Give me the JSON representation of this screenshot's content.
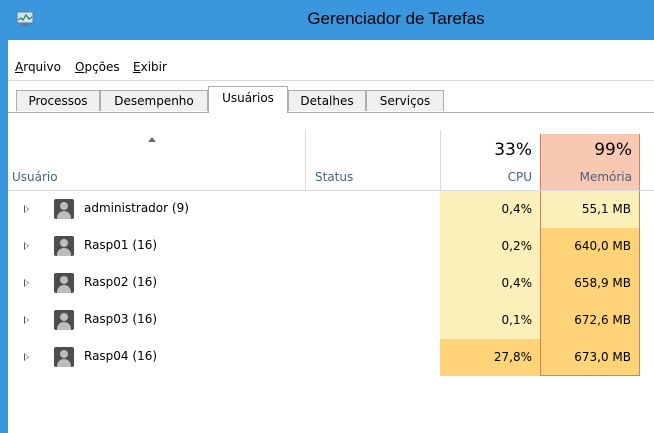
{
  "window": {
    "title": "Gerenciador de Tarefas"
  },
  "menu": [
    {
      "label": "Arquivo",
      "accel": "A",
      "rest": "rquivo"
    },
    {
      "label": "Opções",
      "accel": "O",
      "rest": "pções"
    },
    {
      "label": "Exibir",
      "accel": "E",
      "rest": "xibir"
    }
  ],
  "tabs": [
    "Processos",
    "Desempenho",
    "Usuários",
    "Detalhes",
    "Serviços"
  ],
  "active_tab": "Usuários",
  "columns": {
    "user": "Usuário",
    "status": "Status",
    "cpu": {
      "label": "CPU",
      "pct": "33%"
    },
    "memory": {
      "label": "Memória",
      "pct": "99%"
    }
  },
  "rows": [
    {
      "name": "administrador (9)",
      "status": "",
      "cpu": "0,4%",
      "memory": "55,1 MB"
    },
    {
      "name": "Rasp01 (16)",
      "status": "",
      "cpu": "0,2%",
      "memory": "640,0 MB"
    },
    {
      "name": "Rasp02 (16)",
      "status": "",
      "cpu": "0,4%",
      "memory": "658,9 MB"
    },
    {
      "name": "Rasp03 (16)",
      "status": "",
      "cpu": "0,1%",
      "memory": "672,6 MB"
    },
    {
      "name": "Rasp04 (16)",
      "status": "",
      "cpu": "27,8%",
      "memory": "673,0 MB"
    }
  ],
  "colors": {
    "titlebar": "#3a96dd",
    "cpu_low": "#fbf0ba",
    "cpu_high": "#ffd377",
    "mem_low": "#fbf0ba",
    "mem_high": "#ffd377",
    "mem_header": "#f9c8b3",
    "mem_border": "#e07b52"
  }
}
